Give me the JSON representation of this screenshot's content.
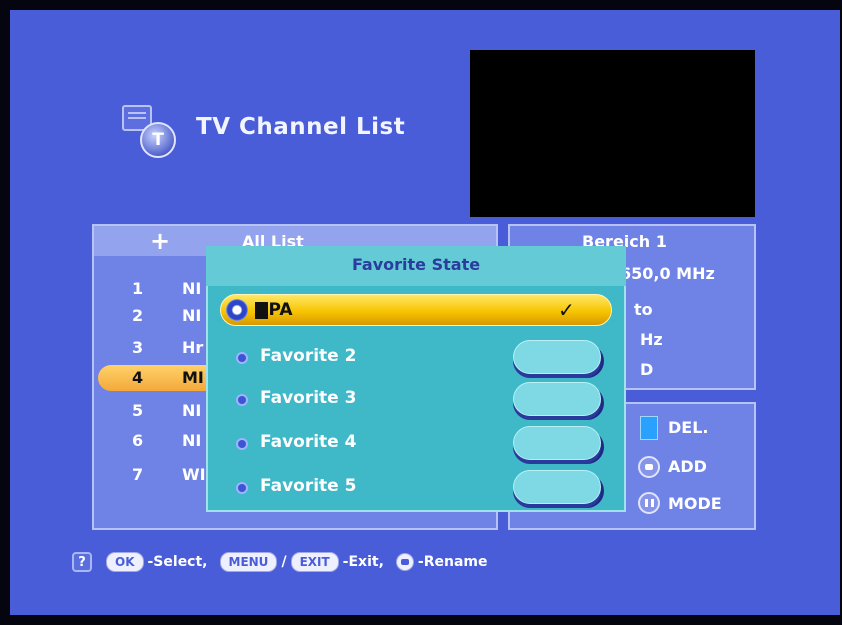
{
  "header": {
    "title": "TV Channel List",
    "badge_letter": "T",
    "icon": "channel-list-icon"
  },
  "channel_list": {
    "list_name": "All List",
    "add_icon": "plus-icon",
    "rows": [
      {
        "num": "1",
        "name": "NI"
      },
      {
        "num": "2",
        "name": "NI"
      },
      {
        "num": "3",
        "name": "Hr"
      },
      {
        "num": "4",
        "name": "MI",
        "selected": true
      },
      {
        "num": "5",
        "name": "NI"
      },
      {
        "num": "6",
        "name": "NI"
      },
      {
        "num": "7",
        "name": "WI"
      }
    ]
  },
  "info": {
    "line1": "Bereich 1",
    "line2": "650,0 MHz",
    "line3": "to",
    "line4": "Hz",
    "line5": "D"
  },
  "legend": {
    "del": "DEL.",
    "add": "ADD",
    "mode": "MODE"
  },
  "dialog": {
    "title": "Favorite State",
    "items": [
      {
        "label": "CPA",
        "checked": true,
        "check": "✓"
      },
      {
        "label": "Favorite 2",
        "checked": false
      },
      {
        "label": "Favorite 3",
        "checked": false
      },
      {
        "label": "Favorite 4",
        "checked": false
      },
      {
        "label": "Favorite 5",
        "checked": false
      }
    ]
  },
  "help": {
    "help_icon": "?",
    "ok_key": "OK",
    "select_text": "-Select,",
    "menu_key": "MENU",
    "slash": "/",
    "exit_key": "EXIT",
    "exit_text": "-Exit,",
    "rename_text": "-Rename"
  },
  "colors": {
    "background": "#4a5dd8",
    "dialog": "#3fb8c8",
    "highlight": "#f7c400",
    "selected_row": "#f4a83a"
  }
}
